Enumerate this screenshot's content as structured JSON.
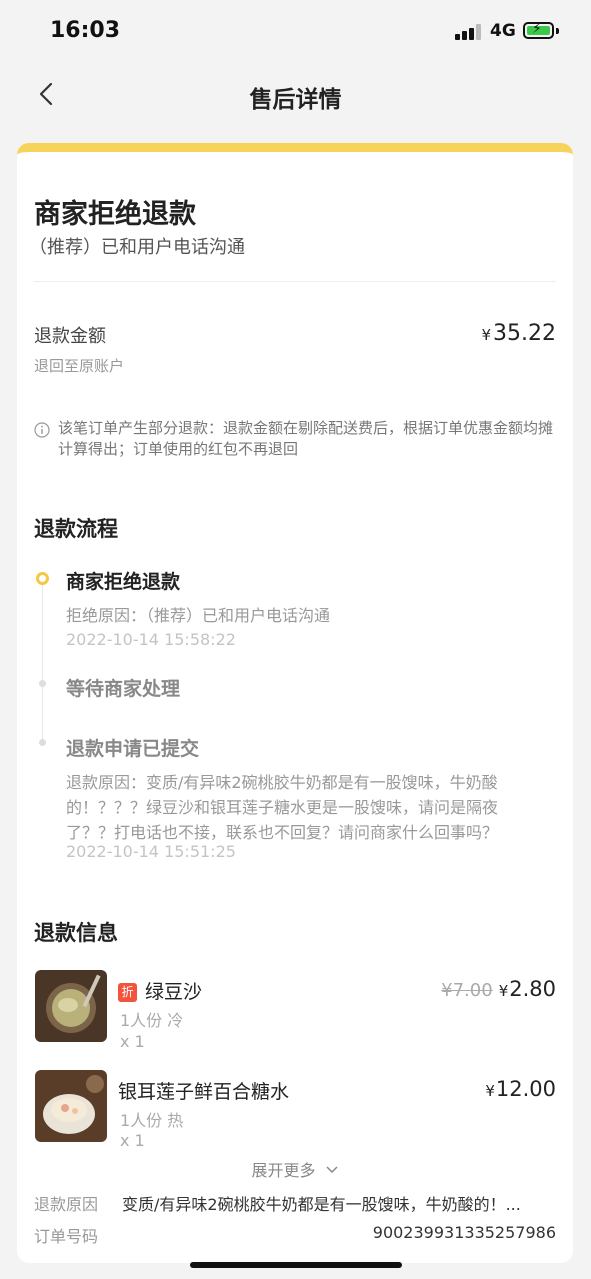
{
  "status_bar": {
    "time": "16:03",
    "network": "4G"
  },
  "nav": {
    "title": "售后详情",
    "back_icon": "chevron-left-icon"
  },
  "refund_status": {
    "title": "商家拒绝退款",
    "subtitle": "（推荐）已和用户电话沟通"
  },
  "refund_amount": {
    "label": "退款金额",
    "destination": "退回至原账户",
    "currency": "¥",
    "value": "35.22",
    "notice": "该笔订单产生部分退款：退款金额在剔除配送费后，根据订单优惠金额均摊计算得出；订单使用的红包不再退回"
  },
  "process": {
    "title": "退款流程",
    "steps": [
      {
        "title": "商家拒绝退款",
        "detail": "拒绝原因：（推荐）已和用户电话沟通",
        "time": "2022-10-14 15:58:22"
      },
      {
        "title": "等待商家处理"
      },
      {
        "title": "退款申请已提交",
        "detail": "退款原因：变质/有异味2碗桃胶牛奶都是有一股馊味，牛奶酸的！？？？绿豆沙和银耳莲子糖水更是一股馊味，请问是隔夜了？？打电话也不接，联系也不回复？请问商家什么回事吗？",
        "time": "2022-10-14 15:51:25"
      }
    ]
  },
  "refund_info": {
    "title": "退款信息",
    "items": [
      {
        "tag": "折",
        "name": "绿豆沙",
        "spec": "1人份 冷",
        "qty": "x 1",
        "original_price": "¥7.00",
        "currency": "¥",
        "price": "2.80"
      },
      {
        "name": "银耳莲子鲜百合糖水",
        "spec": "1人份 热",
        "qty": "x 1",
        "currency": "¥",
        "price": "12.00"
      }
    ],
    "expand_label": "展开更多",
    "reason_label": "退款原因",
    "reason_value": "变质/有异味2碗桃胶牛奶都是有一股馊味，牛奶酸的！...",
    "order_label": "订单号码",
    "order_value": "900239931335257986"
  },
  "colors": {
    "accent": "#f6d35a",
    "discount_tag": "#f2543d"
  }
}
